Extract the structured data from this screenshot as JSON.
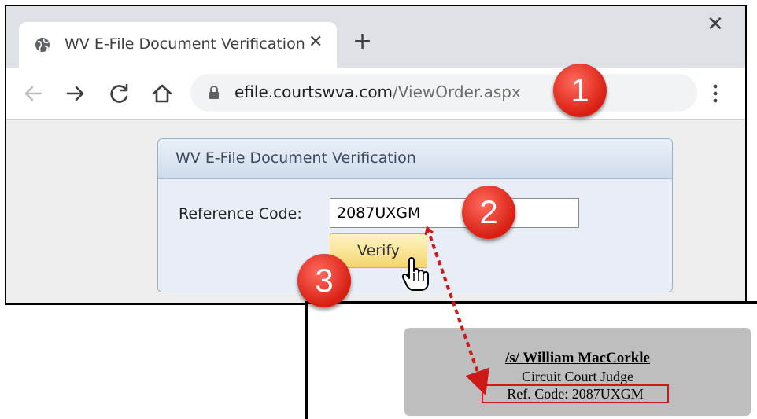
{
  "browser": {
    "tab_title": "WV E-File Document Verification",
    "tab_close": "✕",
    "new_tab": "+",
    "window_close": "✕",
    "url_host": "efile.courtswva.com",
    "url_path": "/ViewOrder.aspx"
  },
  "form": {
    "title": "WV E-File Document Verification",
    "ref_label": "Reference Code:",
    "ref_value": "2087UXGM",
    "verify_label": "Verify"
  },
  "document": {
    "signature": "/s/ William MacCorkle",
    "signer_title": "Circuit Court Judge",
    "ref_code": "Ref. Code: 2087UXGM"
  },
  "steps": [
    "1",
    "2",
    "3"
  ],
  "colors": {
    "badge": "#e2291f",
    "highlight": "#d11818",
    "verify_button": "#f4d66f"
  }
}
